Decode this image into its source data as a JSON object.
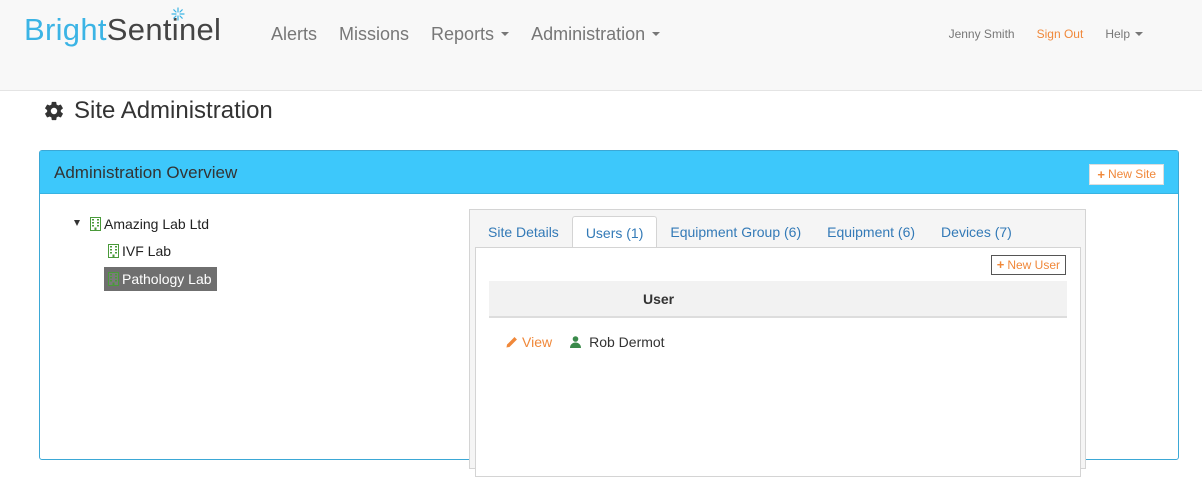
{
  "brand": {
    "part1": "Bright",
    "part2": "Sentinel"
  },
  "nav": {
    "left": [
      {
        "label": "Alerts",
        "dropdown": false
      },
      {
        "label": "Missions",
        "dropdown": false
      },
      {
        "label": "Reports",
        "dropdown": true
      },
      {
        "label": "Administration",
        "dropdown": true
      }
    ],
    "user": "Jenny Smith",
    "signout": "Sign Out",
    "help": "Help"
  },
  "page": {
    "title": "Site Administration"
  },
  "panel": {
    "title": "Administration Overview",
    "new_site": "New Site"
  },
  "tree": {
    "root": "Amazing Lab Ltd",
    "children": [
      {
        "label": "IVF Lab",
        "selected": false
      },
      {
        "label": "Pathology Lab",
        "selected": true
      }
    ]
  },
  "tabs": [
    {
      "label": "Site Details",
      "active": false
    },
    {
      "label": "Users (1)",
      "active": true
    },
    {
      "label": "Equipment Group (6)",
      "active": false
    },
    {
      "label": "Equipment (6)",
      "active": false
    },
    {
      "label": "Devices (7)",
      "active": false
    }
  ],
  "users_tab": {
    "new_user": "New User",
    "column": "User",
    "rows": [
      {
        "action": "View",
        "name": "Rob Dermot"
      }
    ]
  },
  "colors": {
    "accent": "#f0883a",
    "panel_heading": "#3dc8fb",
    "link": "#337ab7",
    "brand_blue": "#3bb4e5"
  }
}
